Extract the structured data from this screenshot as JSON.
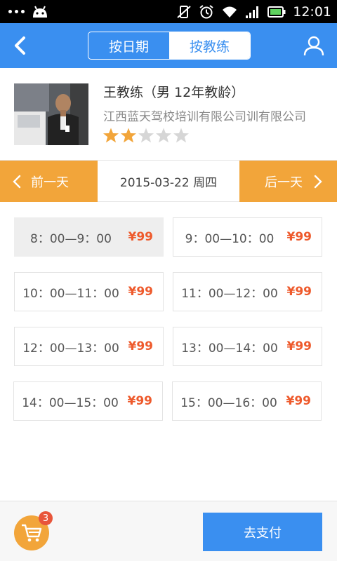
{
  "status_bar": {
    "time": "12:01"
  },
  "nav": {
    "tabs": [
      {
        "label": "按日期",
        "active": false
      },
      {
        "label": "按教练",
        "active": true
      }
    ]
  },
  "coach": {
    "name": "王教练（男 12年教龄）",
    "school": "江西蓝天驾校培训有限公司训有限公司",
    "rating": 2,
    "rating_max": 5,
    "star_color": "#f2a53a"
  },
  "date_bar": {
    "prev_label": "前一天",
    "current": "2015-03-22 周四",
    "next_label": "后一天"
  },
  "slots": [
    {
      "time": "8：00—9：00",
      "price": "¥99",
      "selected": true
    },
    {
      "time": "9：00—10：00",
      "price": "¥99",
      "selected": false
    },
    {
      "time": "10：00—11：00",
      "price": "¥99",
      "selected": false
    },
    {
      "time": "11：00—12：00",
      "price": "¥99",
      "selected": false
    },
    {
      "time": "12：00—13：00",
      "price": "¥99",
      "selected": false
    },
    {
      "time": "13：00—14：00",
      "price": "¥99",
      "selected": false
    },
    {
      "time": "14：00—15：00",
      "price": "¥99",
      "selected": false
    },
    {
      "time": "15：00—16：00",
      "price": "¥99",
      "selected": false
    }
  ],
  "bottom": {
    "cart_count": "3",
    "pay_label": "去支付"
  },
  "colors": {
    "primary": "#3a8ff0",
    "accent": "#f2a53a",
    "price": "#ee5a2c"
  }
}
